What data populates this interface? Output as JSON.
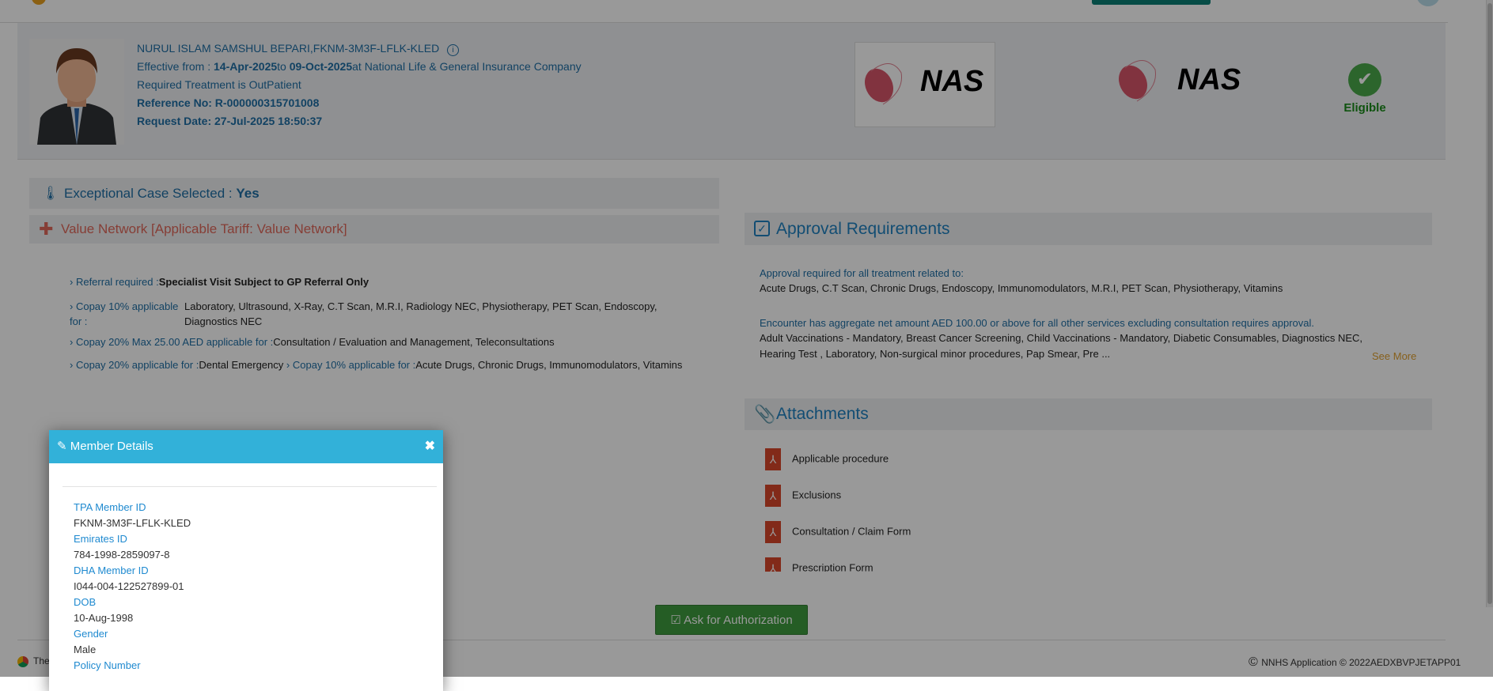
{
  "header": {
    "member_name": "NURUL ISLAM SAMSHUL BEPARI,",
    "member_id": "FKNM-3M3F-LFLK-KLED",
    "effective_label": "Effective from : ",
    "effective_from": "14-Apr-2025",
    "to_label": "to ",
    "effective_to": "09-Oct-2025",
    "insurer": "at National Life & General Insurance Company",
    "treatment": "Required Treatment is OutPatient",
    "reference": "Reference No: R-000000315701008",
    "request_date": "Request Date: 27-Jul-2025 18:50:37",
    "logo_text": "NAS",
    "status": "Eligible",
    "status_color": "#4aa84a"
  },
  "exceptional": {
    "label": "Exceptional Case Selected : ",
    "value": "Yes"
  },
  "network": {
    "title": "Value Network [Applicable Tariff: Value Network]"
  },
  "benefits": [
    {
      "label": "Referral required :",
      "value": "Specialist Visit Subject to GP Referral Only"
    },
    {
      "label": "Copay 10% applicable for :",
      "value": "Laboratory, Ultrasound, X-Ray, C.T Scan, M.R.I, Radiology NEC, Physiotherapy, PET Scan, Endoscopy, Diagnostics NEC"
    },
    {
      "label": "Copay 20% Max 25.00 AED applicable for :",
      "value": "Consultation / Evaluation and Management, Teleconsultations"
    },
    {
      "label": "Copay 20% applicable for :",
      "value": "Dental Emergency"
    },
    {
      "label": "Copay 10% applicable for :",
      "value": "Acute Drugs, Chronic Drugs, Immunomodulators, Vitamins"
    }
  ],
  "approval": {
    "title": "Approval Requirements",
    "line1_label": "Approval required for all treatment related to:",
    "line1_value": "Acute Drugs, C.T Scan, Chronic Drugs, Endoscopy, Immunomodulators, M.R.I, PET Scan, Physiotherapy, Vitamins",
    "line2_label": "Encounter has aggregate net amount AED 100.00 or above for all other services excluding consultation requires approval.",
    "line2_value_a": "Adult Vaccinations - Mandatory, Breast Cancer Screening, Child Vaccinations - Mandatory, Diabetic Consumables, Diagnostics NEC,",
    "line2_value_b": "Hearing Test , Laboratory, Non-surgical minor procedures, Pap Smear, Pre ...",
    "see_more": "See More"
  },
  "attachments": {
    "title": "Attachments",
    "items": [
      "Applicable procedure",
      "Exclusions",
      "Consultation / Claim Form",
      "Prescription Form"
    ]
  },
  "ask_button": "Ask for Authorization",
  "footer": {
    "left": "The",
    "right": "NNHS Application © 2022AEDXBVPJETAPP01"
  },
  "modal": {
    "title": "Member Details",
    "fields": [
      {
        "label": "TPA Member ID",
        "value": "FKNM-3M3F-LFLK-KLED"
      },
      {
        "label": "Emirates ID",
        "value": "784-1998-2859097-8"
      },
      {
        "label": "DHA Member ID",
        "value": "I044-004-122527899-01"
      },
      {
        "label": "DOB",
        "value": "10-Aug-1998"
      },
      {
        "label": "Gender",
        "value": "Male"
      },
      {
        "label": "Policy Number",
        "value": ""
      }
    ]
  }
}
